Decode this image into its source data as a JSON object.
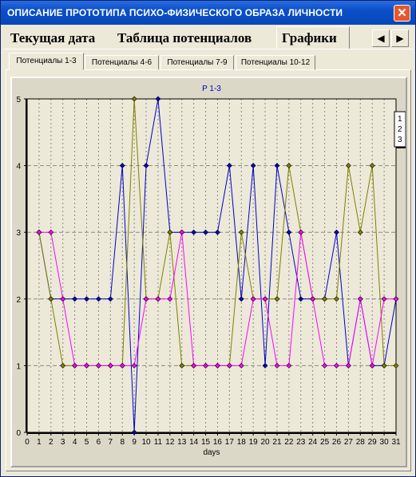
{
  "window": {
    "title": "ОПИСАНИЕ ПРОТОТИПА ПСИХО-ФИЗИЧЕСКОГО ОБРАЗА ЛИЧНОСТИ",
    "close_glyph": "✕"
  },
  "main_tabs": [
    {
      "label": "Текущая дата",
      "active": false
    },
    {
      "label": "Таблица потенциалов",
      "active": false
    },
    {
      "label": "Графики",
      "active": true
    }
  ],
  "nav_arrows": {
    "prev": "◀",
    "next": "▶"
  },
  "sub_tabs": [
    {
      "label": "Потенциалы 1-3",
      "active": true
    },
    {
      "label": "Потенциалы 4-6",
      "active": false
    },
    {
      "label": "Потенциалы 7-9",
      "active": false
    },
    {
      "label": "Потенциалы 10-12",
      "active": false
    }
  ],
  "chart_data": {
    "type": "line",
    "title": "P 1-3",
    "xlabel": "days",
    "ylabel": "",
    "xlim": [
      0,
      31
    ],
    "ylim": [
      0,
      5
    ],
    "x_ticks": [
      0,
      1,
      2,
      3,
      4,
      5,
      6,
      7,
      8,
      9,
      10,
      11,
      12,
      13,
      14,
      15,
      16,
      17,
      18,
      19,
      20,
      21,
      22,
      23,
      24,
      25,
      26,
      27,
      28,
      29,
      30,
      31
    ],
    "y_ticks": [
      0,
      1,
      2,
      3,
      4,
      5
    ],
    "grid": true,
    "legend_position": "top-right",
    "x": [
      1,
      2,
      3,
      4,
      5,
      6,
      7,
      8,
      9,
      10,
      11,
      12,
      13,
      14,
      15,
      16,
      17,
      18,
      19,
      20,
      21,
      22,
      23,
      24,
      25,
      26,
      27,
      28,
      29,
      30,
      31
    ],
    "series": [
      {
        "name": "1",
        "color": "#0000c8",
        "values": [
          3,
          2,
          2,
          2,
          2,
          2,
          2,
          4,
          0,
          4,
          5,
          3,
          3,
          3,
          3,
          3,
          4,
          2,
          4,
          1,
          4,
          3,
          2,
          2,
          2,
          3,
          1,
          2,
          1,
          1,
          2
        ]
      },
      {
        "name": "2",
        "color": "#808000",
        "values": [
          3,
          2,
          1,
          1,
          1,
          1,
          1,
          1,
          5,
          2,
          2,
          3,
          1,
          1,
          1,
          1,
          1,
          3,
          2,
          2,
          2,
          4,
          3,
          2,
          2,
          2,
          4,
          3,
          4,
          1,
          1
        ]
      },
      {
        "name": "3",
        "color": "#ff00ff",
        "values": [
          3,
          3,
          2,
          1,
          1,
          1,
          1,
          1,
          1,
          2,
          2,
          2,
          3,
          1,
          1,
          1,
          1,
          1,
          2,
          2,
          1,
          1,
          3,
          2,
          1,
          1,
          1,
          2,
          1,
          2,
          2
        ]
      }
    ]
  }
}
